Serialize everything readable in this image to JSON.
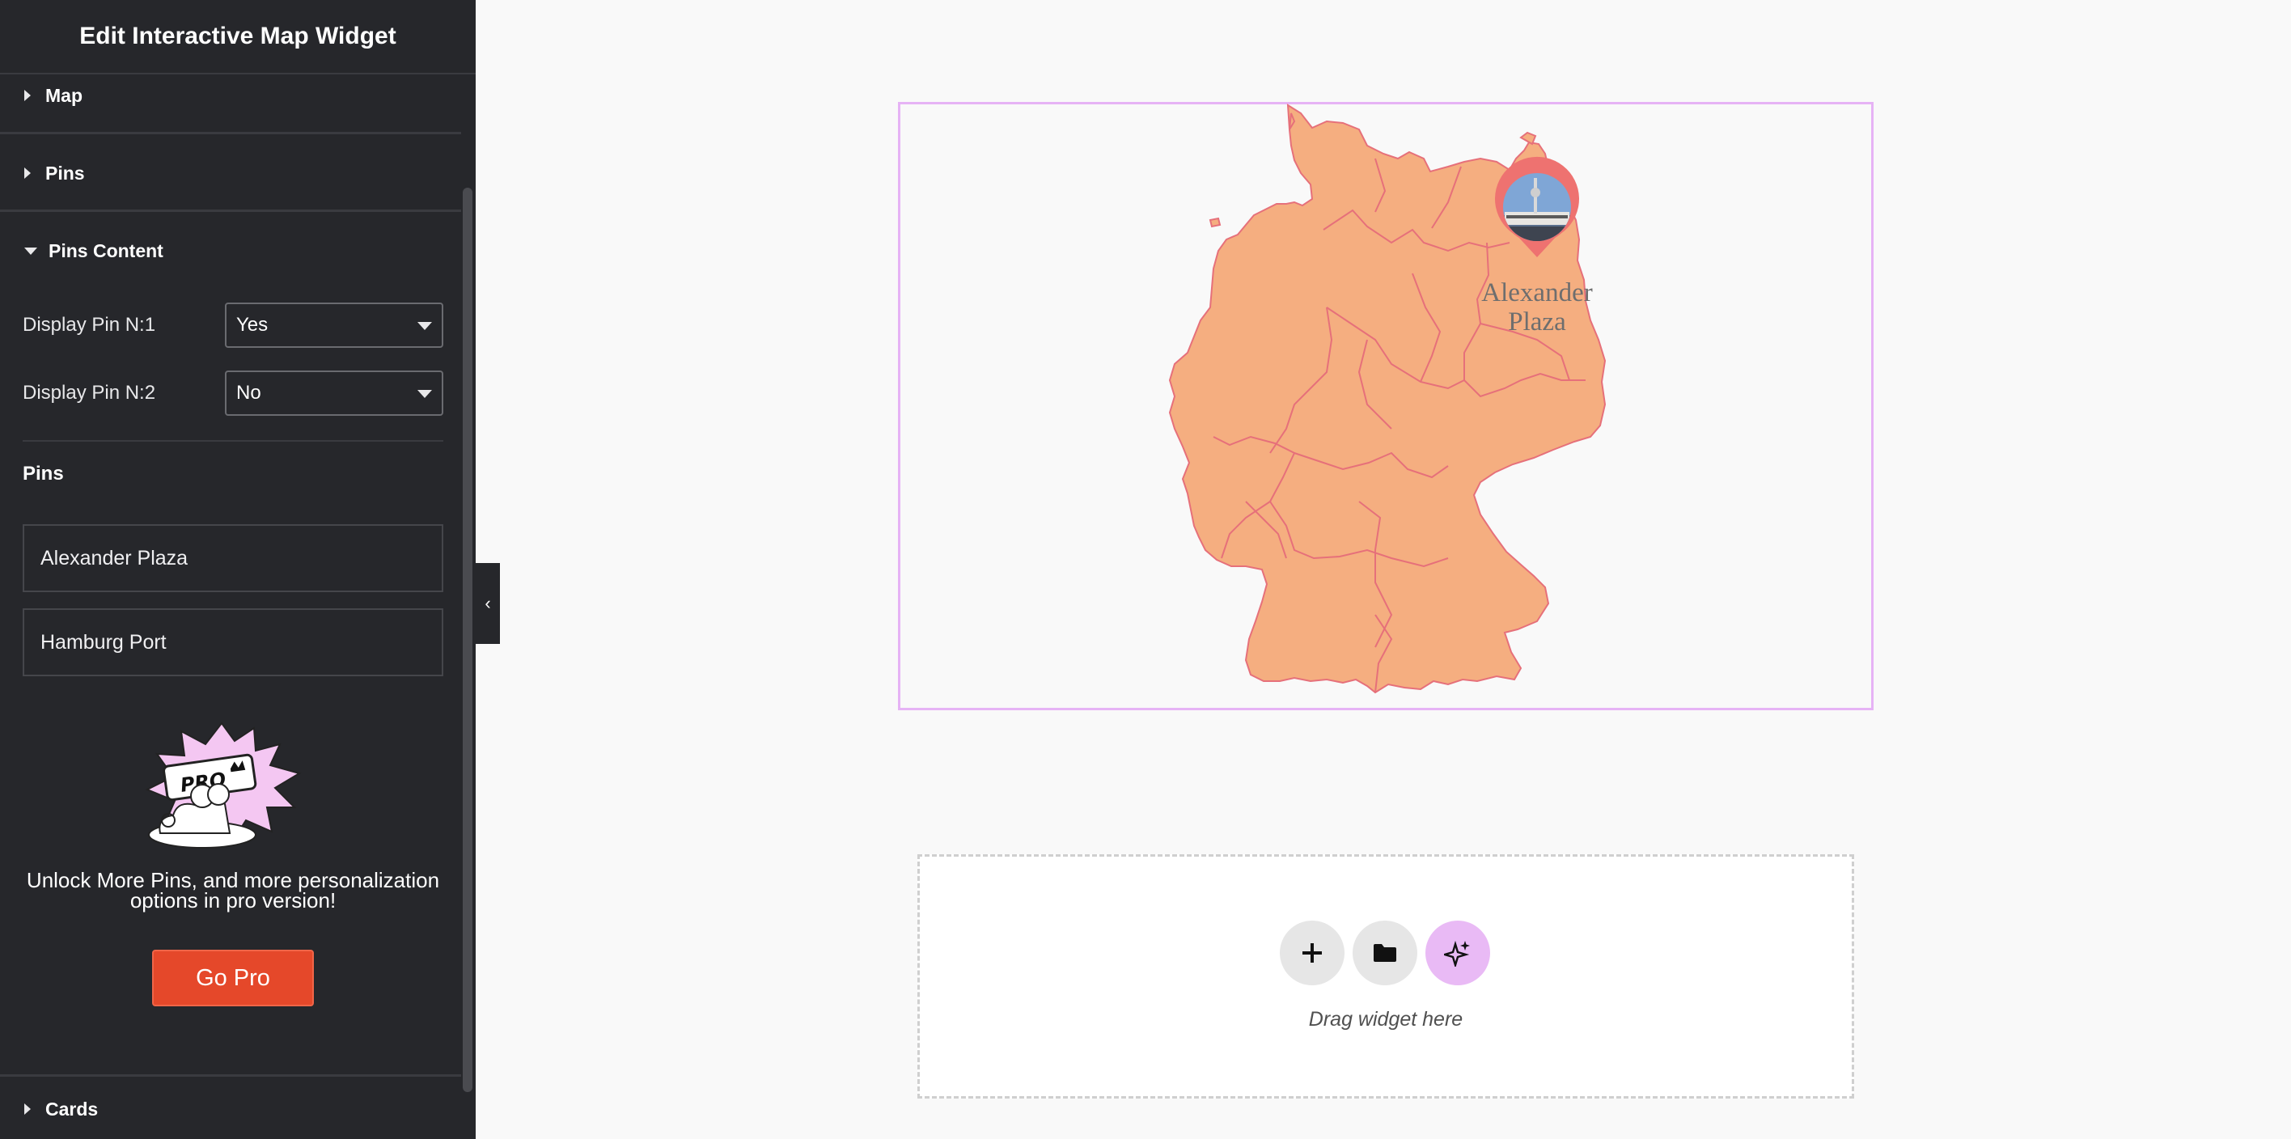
{
  "panel": {
    "title": "Edit Interactive Map Widget",
    "sections": {
      "map": "Map",
      "pins": "Pins",
      "pins_content": "Pins Content",
      "cards": "Cards"
    },
    "display_pin_1": {
      "label": "Display Pin N:1",
      "value": "Yes"
    },
    "display_pin_2": {
      "label": "Display Pin N:2",
      "value": "No"
    },
    "pins_heading": "Pins",
    "pins": [
      "Alexander Plaza",
      "Hamburg Port"
    ],
    "promo_text": "Unlock More Pins, and more personalization options in pro version!",
    "go_pro_label": "Go Pro",
    "pro_badge": "PRO"
  },
  "canvas": {
    "map_pin_label": "Alexander Plaza",
    "dropzone_hint": "Drag widget here"
  },
  "colors": {
    "map_fill": "#f5ae80",
    "map_border": "#e6707a",
    "pin": "#ee7270",
    "widget_border": "#e6b3f5",
    "go_pro": "#e5482a",
    "ai_button": "#e9baf5"
  }
}
